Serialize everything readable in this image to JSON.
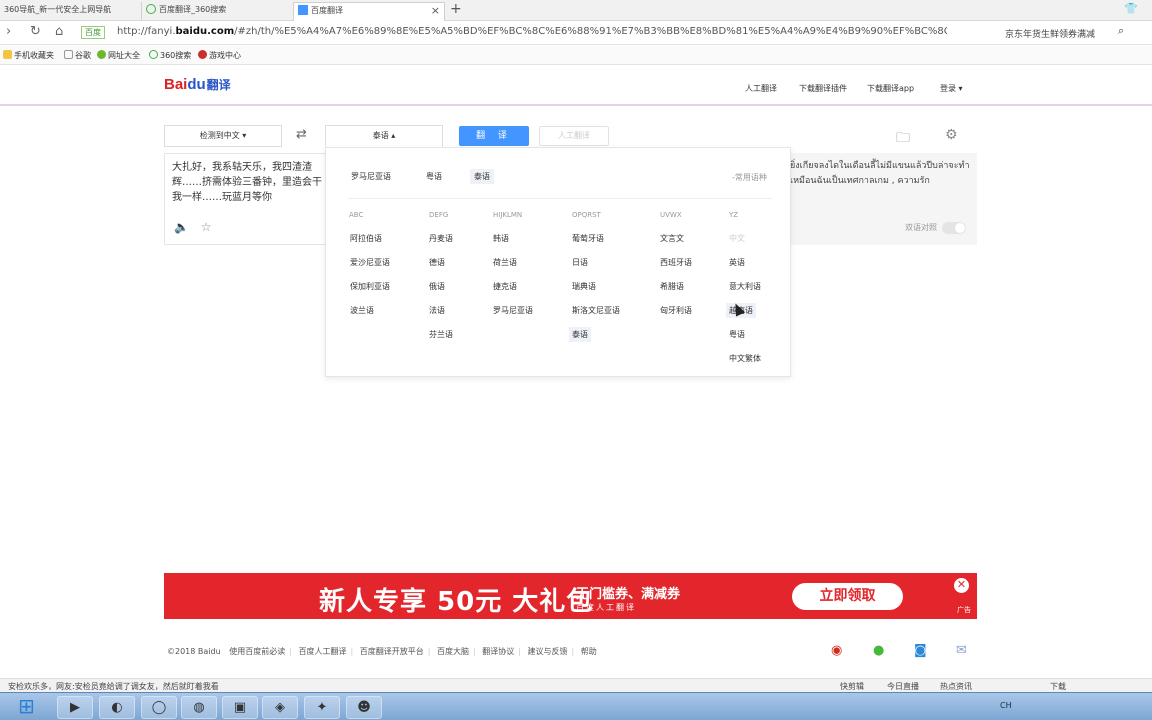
{
  "browser": {
    "tabs": [
      {
        "label": "360导航_新一代安全上网导航"
      },
      {
        "label": "百度翻译_360搜索"
      },
      {
        "label": "百度翻译",
        "close": "×"
      }
    ],
    "new_tab": "+",
    "url_badge": "百度 ",
    "url_prefix": "http://fanyi.",
    "url_domain": "baidu.com",
    "url_rest": "/#zh/th/%E5%A4%A7%E6%89%8E%E5%A5%BD%EF%BC%8C%E6%88%91%E7%B3%BB%E8%BD%81%E5%A4%A9%E4%B9%90%EF%BC%8C%E6%88%9",
    "addr_promo": "京东年货生鲜领券满减",
    "bookmarks": [
      "手机收藏夹",
      "谷歌",
      "网址大全",
      "360搜索",
      "游戏中心"
    ]
  },
  "header": {
    "logo_bai": "Bai",
    "logo_du": "du",
    "logo_fanyi": "翻译",
    "links": [
      "人工翻译",
      "下载翻译插件",
      "下载翻译app",
      "登录 ▾"
    ]
  },
  "toolbar": {
    "source_lang": "检测到中文 ▾",
    "swap": "⇄",
    "target_lang": "泰语 ▴",
    "translate": "翻 译",
    "human": "人工翻译"
  },
  "input": {
    "text": "大扎好，我系轱天乐，我四渣渣辉……挤需体验三番钟，里造会干我一样……玩蓝月等你"
  },
  "output": {
    "text": "ยิ่งเกียจลงไดในเดือนลี้ไม่มีแขนแล้วปีบล่าจะทำเหมือนฉันเป็นเทศกาลเกม , ความรัก",
    "bilingual_label": "双语对照"
  },
  "dropdown": {
    "recent": [
      "罗马尼亚语",
      "粤语",
      "泰语"
    ],
    "recent_selected": "泰语",
    "recent_label": "-常用语种",
    "groups": [
      {
        "header": "ABC",
        "langs": [
          "阿拉伯语",
          "爱沙尼亚语",
          "保加利亚语",
          "波兰语"
        ]
      },
      {
        "header": "DEFG",
        "langs": [
          "丹麦语",
          "德语",
          "俄语",
          "法语",
          "芬兰语"
        ]
      },
      {
        "header": "HIJKLMN",
        "langs": [
          "韩语",
          "荷兰语",
          "捷克语",
          "罗马尼亚语"
        ]
      },
      {
        "header": "OPQRST",
        "langs": [
          "葡萄牙语",
          "日语",
          "瑞典语",
          "斯洛文尼亚语",
          "泰语"
        ]
      },
      {
        "header": "UVWX",
        "langs": [
          "文言文",
          "西班牙语",
          "希腊语",
          "匈牙利语"
        ]
      },
      {
        "header": "YZ",
        "langs": [
          "中文",
          "英语",
          "意大利语",
          "越南语",
          "粤语",
          "中文繁体"
        ]
      }
    ],
    "selected": "泰语",
    "disabled": "中文"
  },
  "banner": {
    "main": "新人专享 50元 大礼包",
    "sub": "无门槛券、满减券",
    "sub2": "百度人工翻译",
    "cta": "立即领取",
    "close": "✕",
    "ad": "广告"
  },
  "footer": {
    "copyright": "©2018 Baidu",
    "links": [
      "使用百度前必读",
      "百度人工翻译",
      "百度翻译开放平台",
      "百度大脑",
      "翻译协议",
      "建议与反馈",
      "帮助"
    ]
  },
  "status": {
    "text": "安检欢乐多，网友:安检员竟给调了调女友，然后就盯着我看",
    "right": [
      "快剪辑",
      "今日直播",
      "热点资讯",
      "下载"
    ]
  },
  "taskbar": {
    "tray_time": "CH"
  },
  "colors": {
    "accent": "#4395ff",
    "banner": "#e3262c",
    "brand_red": "#de1f26",
    "brand_blue": "#2a54c7"
  }
}
